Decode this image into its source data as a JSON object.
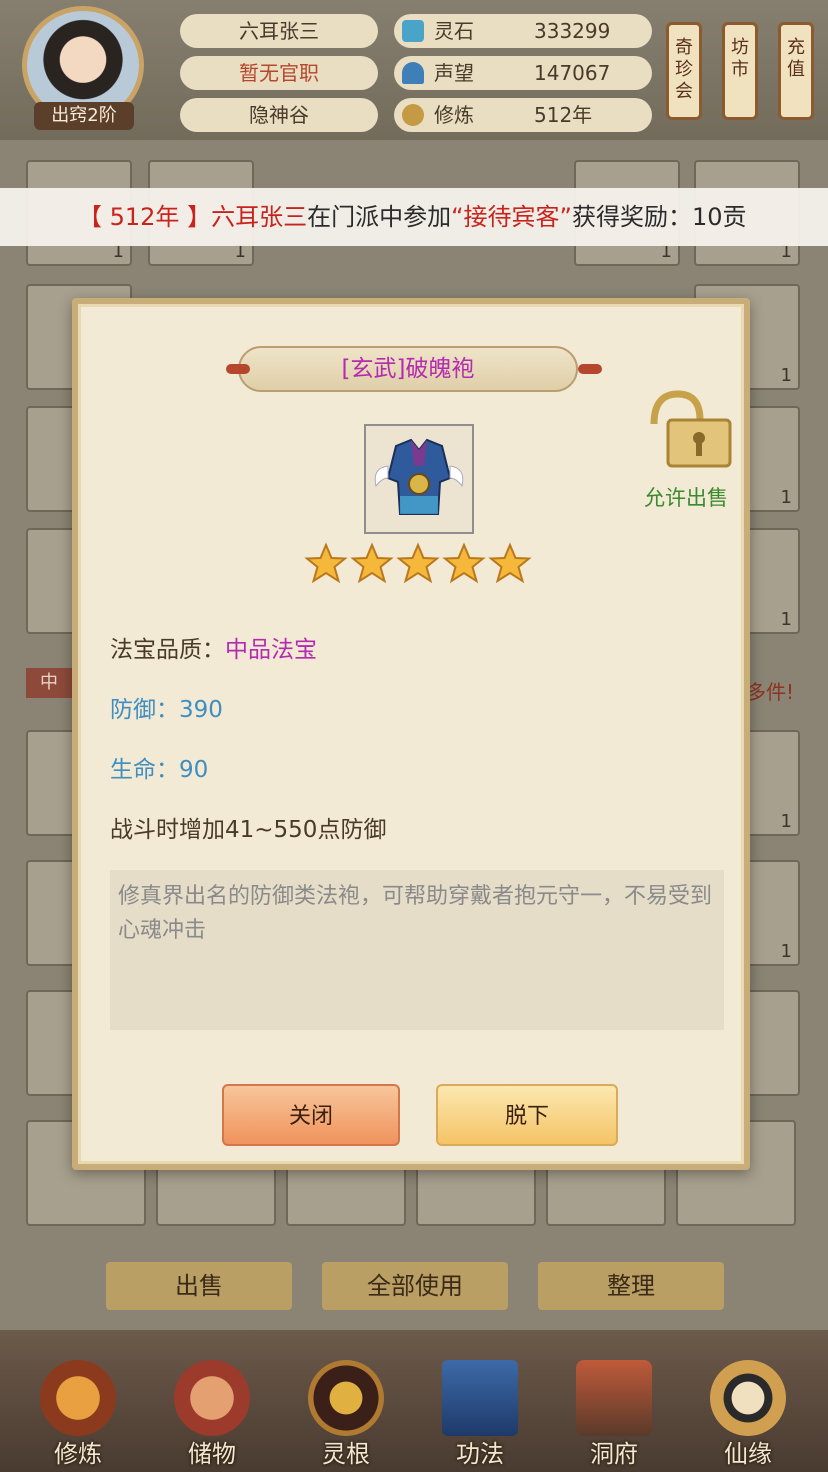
{
  "header": {
    "rank": "出窍2阶",
    "player_name": "六耳张三",
    "official_post": "暂无官职",
    "sect": "隐神谷",
    "resources": [
      {
        "label": "灵石",
        "value": "333299",
        "icon": "spirit-stone-icon"
      },
      {
        "label": "声望",
        "value": "147067",
        "icon": "prestige-icon"
      },
      {
        "label": "修炼",
        "value": "512年",
        "icon": "cultivation-icon"
      }
    ],
    "side_buttons": [
      "奇珍会",
      "坊市",
      "充值"
    ]
  },
  "marquee": {
    "year": "【 512年 】",
    "name": "六耳张三",
    "mid": "在门派中参加",
    "event": "“接待宾客”",
    "tail": "获得奖励：10贡"
  },
  "background": {
    "slot_count": "1",
    "side_tag": "中",
    "side_note": "多件!",
    "buttons": [
      "出售",
      "全部使用",
      "整理"
    ]
  },
  "dialog": {
    "title": "[玄武]破魄袍",
    "stars": 5,
    "sell_label": "允许出售",
    "quality_label": "法宝品质：",
    "quality_value": "中品法宝",
    "defense": "防御：390",
    "life": "生命：90",
    "effect": "战斗时增加41~550点防御",
    "description": "修真界出名的防御类法袍，可帮助穿戴者抱元守一，不易受到心魂冲击",
    "close_label": "关闭",
    "remove_label": "脱下"
  },
  "nav": [
    {
      "label": "修炼",
      "icon": "cultivate-icon"
    },
    {
      "label": "储物",
      "icon": "storage-bag-icon"
    },
    {
      "label": "灵根",
      "icon": "spirit-root-icon"
    },
    {
      "label": "功法",
      "icon": "technique-book-icon"
    },
    {
      "label": "洞府",
      "icon": "cave-dwelling-icon"
    },
    {
      "label": "仙缘",
      "icon": "immortal-fate-icon"
    }
  ],
  "colors": {
    "title": "#b42ab0",
    "blue_stat": "#3f8ec1",
    "sell_green": "#3a8a2e",
    "marquee_red": "#c8241d"
  }
}
